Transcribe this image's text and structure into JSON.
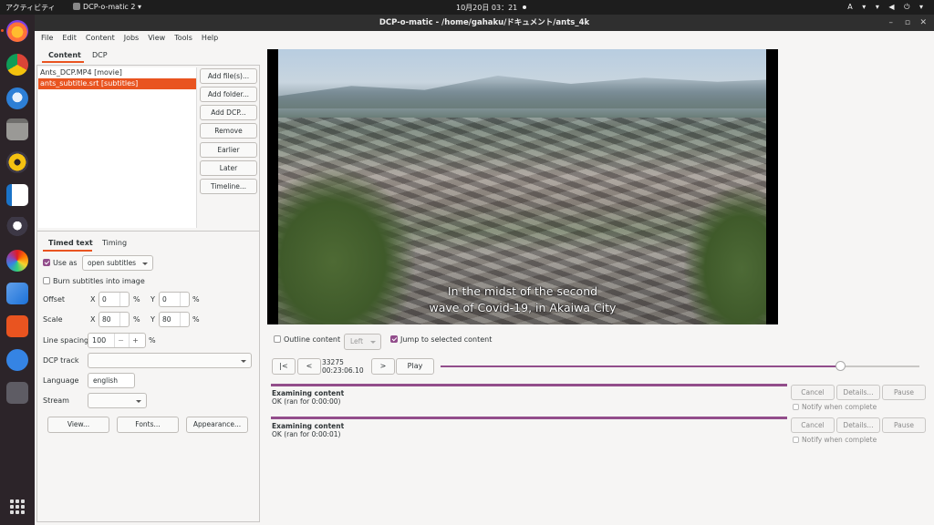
{
  "topbar": {
    "activities": "アクティビティ",
    "app_menu": "DCP-o-matic 2 ▾",
    "clock": "10月20日  03：21",
    "indicators": "A ▾   ▾ ◀ ⏻ ▾"
  },
  "window": {
    "title": "DCP-o-matic - /home/gahaku/ドキュメント/ants_4k",
    "minimize": "–",
    "maximize": "▫",
    "close": "✕"
  },
  "menu": [
    "File",
    "Edit",
    "Content",
    "Jobs",
    "View",
    "Tools",
    "Help"
  ],
  "content_tabs": {
    "content": "Content",
    "dcp": "DCP"
  },
  "files": [
    "Ants_DCP.MP4 [movie]",
    "ants_subtitle.srt [subtitles]"
  ],
  "side_buttons": [
    "Add file(s)...",
    "Add folder...",
    "Add DCP...",
    "Remove",
    "Earlier",
    "Later",
    "Timeline..."
  ],
  "subtabs": {
    "timed_text": "Timed text",
    "timing": "Timing"
  },
  "timed_text": {
    "use_as_label": "Use as",
    "use_as_value": "open subtitles",
    "burn_label": "Burn subtitles into image",
    "offset_label": "Offset",
    "offset_x": "0",
    "offset_y": "0",
    "scale_label": "Scale",
    "scale_x": "80",
    "scale_y": "80",
    "x_label": "X",
    "y_label": "Y",
    "percent": "%",
    "line_spacing_label": "Line spacing",
    "line_spacing_value": "100",
    "minus": "−",
    "plus": "+",
    "dcp_track_label": "DCP track",
    "dcp_track_value": "",
    "language_label": "Language",
    "language_value": "english",
    "stream_label": "Stream",
    "stream_value": "",
    "view_button": "View...",
    "fonts_button": "Fonts...",
    "appearance_button": "Appearance..."
  },
  "viewer": {
    "subtitle_line1": "In the midst of the second",
    "subtitle_line2": "wave of Covid-19, in Akaiwa City"
  },
  "viewer_controls": {
    "outline_label": "Outline content",
    "eye_value": "Left",
    "jump_label": "Jump to selected content",
    "btn_start": "|<",
    "btn_back": "<",
    "btn_forward": ">",
    "btn_play": "Play",
    "frame": "33275",
    "timecode": "00:23:06.10",
    "position_fraction": 0.835
  },
  "jobs": [
    {
      "title": "Examining content",
      "status": "OK (ran for 0:00:00)",
      "cancel": "Cancel",
      "details": "Details...",
      "pause": "Pause",
      "notify": "Notify when complete"
    },
    {
      "title": "Examining content",
      "status": "OK (ran for 0:00:01)",
      "cancel": "Cancel",
      "details": "Details...",
      "pause": "Pause",
      "notify": "Notify when complete"
    }
  ],
  "colors": {
    "accent": "#e95420",
    "progress": "#924d8b"
  },
  "dock_icons": [
    "firefox-icon",
    "chrome-icon",
    "thunderbird-icon",
    "files-icon",
    "rhythmbox-icon",
    "writer-icon",
    "inkscape-icon",
    "color-wheel-icon",
    "app-y-icon",
    "software-icon",
    "help-icon",
    "usb-icon",
    "show-apps-icon"
  ]
}
